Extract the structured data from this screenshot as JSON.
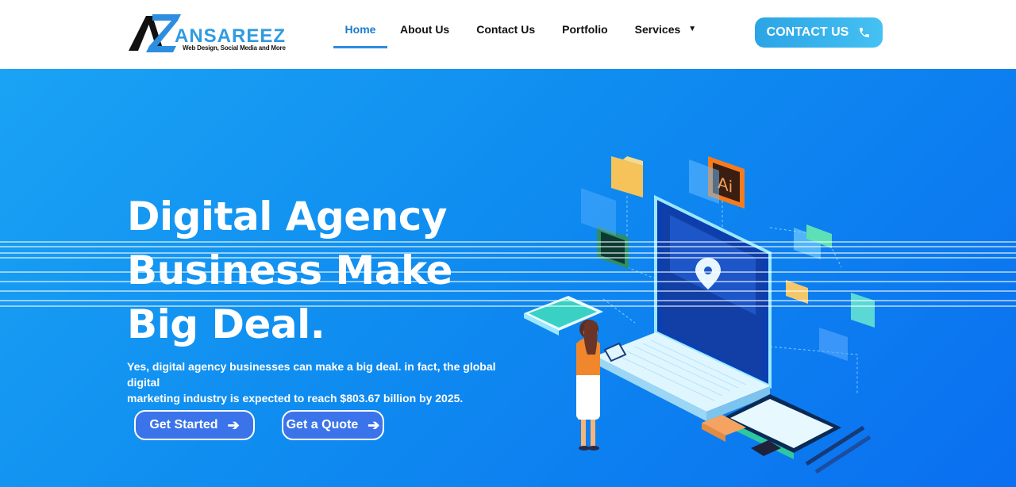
{
  "header": {
    "logo": {
      "name": "ANSAREEZ",
      "tagline": "Web Design, Social Media and More"
    },
    "nav": [
      {
        "label": "Home",
        "active": true
      },
      {
        "label": "About Us"
      },
      {
        "label": "Contact Us"
      },
      {
        "label": "Portfolio"
      },
      {
        "label": "Services",
        "has_dropdown": true
      }
    ],
    "cta": {
      "label": "CONTACT US",
      "icon": "phone-icon"
    }
  },
  "hero": {
    "title_lines": [
      "Digital Agency",
      "Business Make",
      "Big Deal."
    ],
    "description_lines": [
      "Yes, digital agency businesses can make a big deal. in fact, the global digital",
      "marketing industry is expected to reach $803.67 billion by 2025."
    ],
    "buttons": [
      {
        "label": "Get Started",
        "icon": "arrow-right-icon"
      },
      {
        "label": "Get a Quote",
        "icon": "arrow-right-icon"
      }
    ]
  },
  "colors": {
    "brand": "#2f9be0",
    "hero_start": "#1aa3f4",
    "hero_end": "#0a6ff0",
    "cta": "#2ba4e5"
  }
}
